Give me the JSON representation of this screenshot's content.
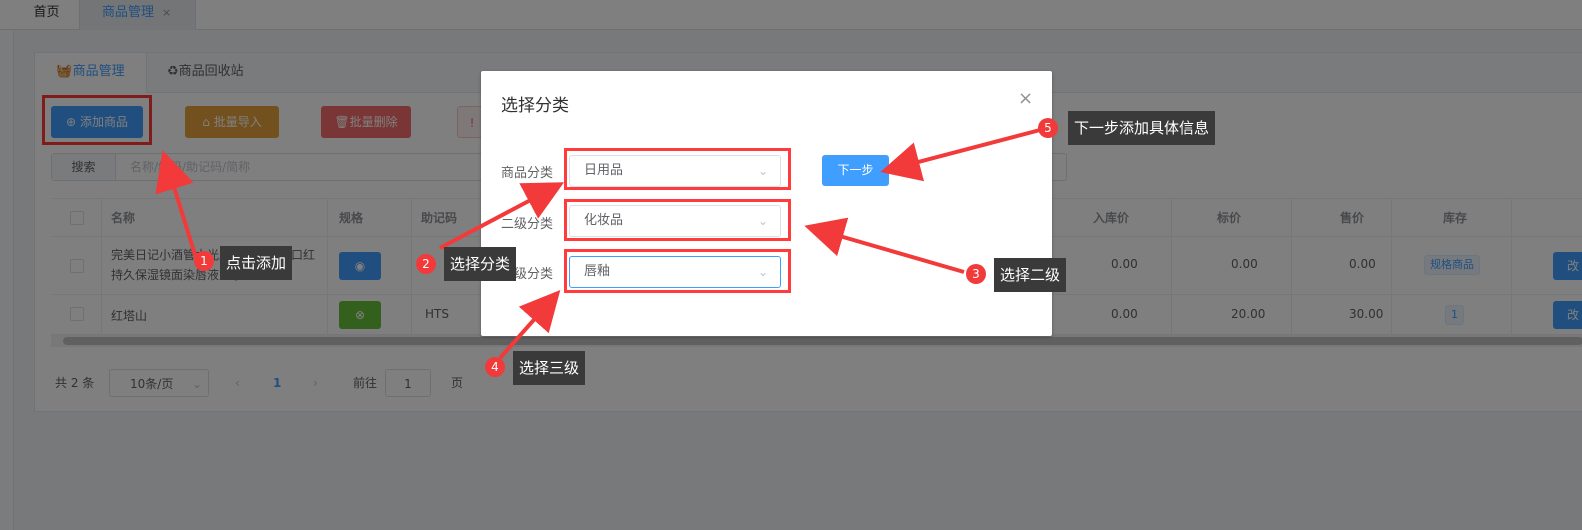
{
  "tabs": {
    "home": "首页",
    "goods": "商品管理",
    "close": "×"
  },
  "subtabs": {
    "manage": "商品管理",
    "recycle": "商品回收站"
  },
  "toolbar": {
    "add": "添加商品",
    "import": "批量导入",
    "delete": "批量删除",
    "warn": "!"
  },
  "search": {
    "label": "搜索",
    "placeholder": "名称/编码/助记码/简称"
  },
  "table": {
    "headers": {
      "name": "名称",
      "spec": "规格",
      "mnemonic": "助记码",
      "in_price": "入库价",
      "list_price": "标价",
      "sale_price": "售价",
      "stock": "库存"
    },
    "rows": [
      {
        "name": "完美日记小酒管水光唇釉唇彩唇蜜口红持久保湿镜面染唇液女学生",
        "mnemonic": "",
        "in_price": "0.00",
        "list_price": "0.00",
        "sale_price": "0.00",
        "stock": "规格商品",
        "edit": "改"
      },
      {
        "name": "红塔山",
        "mnemonic": "HTS",
        "in_price": "0.00",
        "list_price": "20.00",
        "sale_price": "30.00",
        "stock": "1",
        "edit": "改"
      }
    ]
  },
  "pager": {
    "total": "共 2 条",
    "size": "10条/页",
    "current": "1",
    "goto": "前往",
    "goto_value": "1",
    "page_unit": "页"
  },
  "dialog": {
    "title": "选择分类",
    "close": "×",
    "fields": [
      {
        "label": "商品分类",
        "value": "日用品"
      },
      {
        "label": "二级分类",
        "value": "化妆品"
      },
      {
        "label": "三级分类",
        "value": "唇釉"
      }
    ],
    "next": "下一步"
  },
  "annotations": [
    {
      "num": "1",
      "text": "点击添加"
    },
    {
      "num": "2",
      "text": "选择分类"
    },
    {
      "num": "3",
      "text": "选择二级"
    },
    {
      "num": "4",
      "text": "选择三级"
    },
    {
      "num": "5",
      "text": "下一步添加具体信息"
    }
  ],
  "colors": {
    "primary": "#409eff",
    "warning": "#e6a23c",
    "danger": "#f56c6c",
    "success": "#67c23a",
    "highlight": "#ff3b3b"
  }
}
